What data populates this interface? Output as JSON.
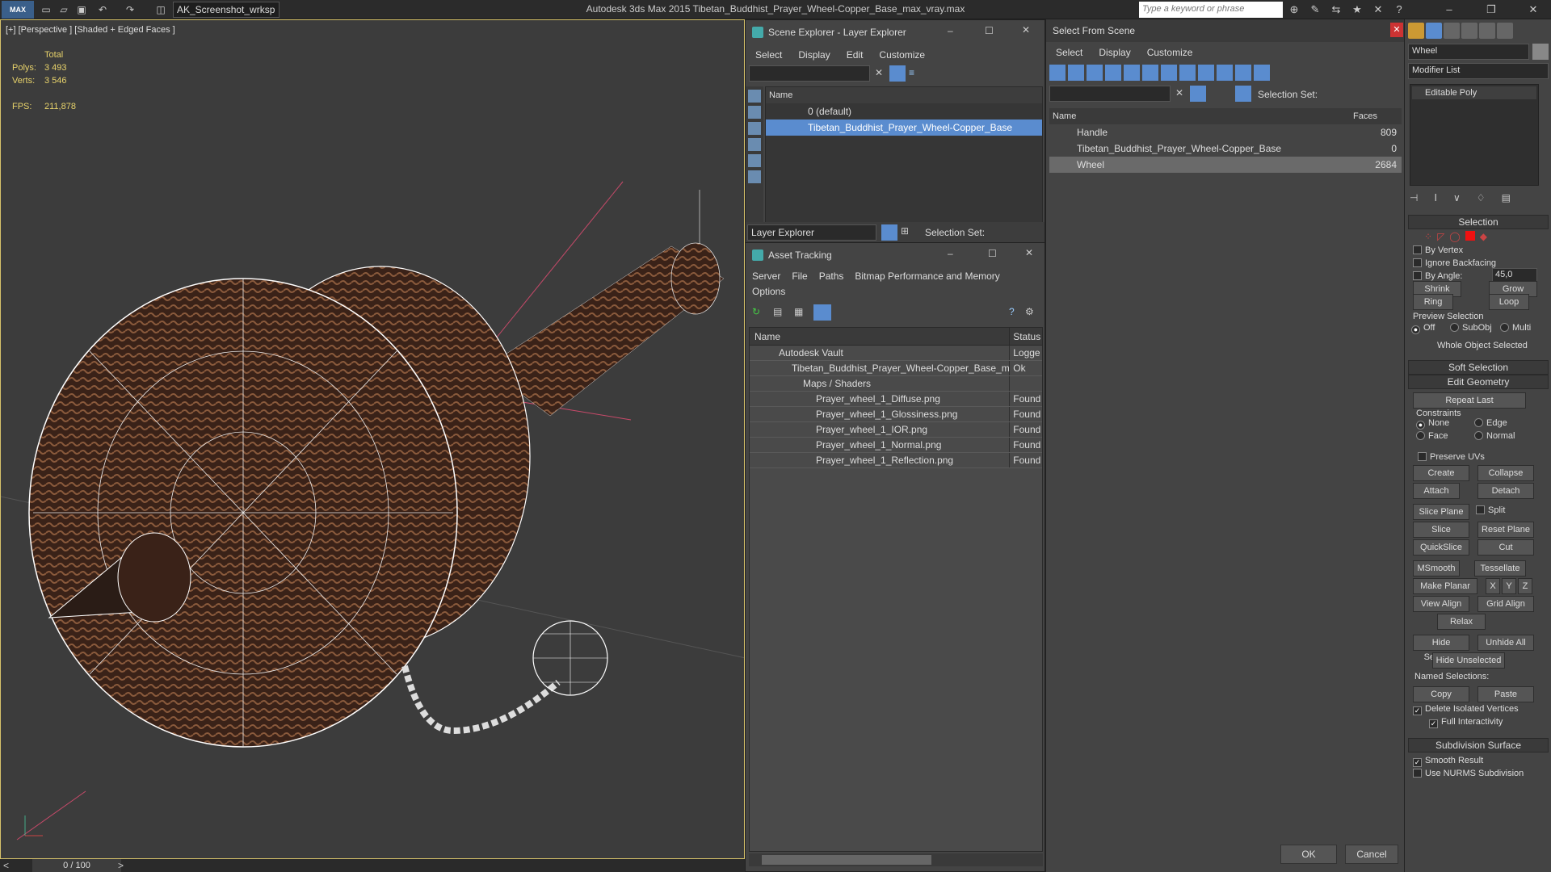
{
  "titlebar": {
    "workspace": "AK_Screenshot_wrksp",
    "app_title": "Autodesk 3ds Max  2015    Tibetan_Buddhist_Prayer_Wheel-Copper_Base_max_vray.max",
    "search_placeholder": "Type a keyword or phrase",
    "logo": "MAX"
  },
  "viewport": {
    "label": "[+] [Perspective ] [Shaded + Edged Faces ]",
    "stats": {
      "total_label": "Total",
      "polys_label": "Polys:",
      "polys": "3 493",
      "verts_label": "Verts:",
      "verts": "3 546",
      "fps_label": "FPS:",
      "fps": "211,878"
    }
  },
  "timeline": {
    "frame": "0 / 100"
  },
  "scene_explorer": {
    "title": "Scene Explorer - Layer Explorer",
    "menu": [
      "Select",
      "Display",
      "Edit",
      "Customize"
    ],
    "column": "Name",
    "rows": [
      "0 (default)",
      "Tibetan_Buddhist_Prayer_Wheel-Copper_Base"
    ],
    "footer_dropdown": "Layer Explorer",
    "selection_set": "Selection Set:"
  },
  "asset_tracking": {
    "title": "Asset Tracking",
    "menu": [
      "Server",
      "File",
      "Paths",
      "Bitmap Performance and Memory"
    ],
    "menu2": "Options",
    "col_name": "Name",
    "col_status": "Status",
    "rows": [
      {
        "name": "Autodesk Vault",
        "status": "Logge"
      },
      {
        "name": "Tibetan_Buddhist_Prayer_Wheel-Copper_Base_m...",
        "status": "Ok"
      },
      {
        "name": "Maps / Shaders",
        "status": ""
      },
      {
        "name": "Prayer_wheel_1_Diffuse.png",
        "status": "Found"
      },
      {
        "name": "Prayer_wheel_1_Glossiness.png",
        "status": "Found"
      },
      {
        "name": "Prayer_wheel_1_IOR.png",
        "status": "Found"
      },
      {
        "name": "Prayer_wheel_1_Normal.png",
        "status": "Found"
      },
      {
        "name": "Prayer_wheel_1_Reflection.png",
        "status": "Found"
      }
    ]
  },
  "select_from_scene": {
    "title": "Select From Scene",
    "menu": [
      "Select",
      "Display",
      "Customize"
    ],
    "selection_set": "Selection Set:",
    "col_name": "Name",
    "col_faces": "Faces",
    "rows": [
      {
        "name": "Handle",
        "faces": "809"
      },
      {
        "name": "Tibetan_Buddhist_Prayer_Wheel-Copper_Base",
        "faces": "0"
      },
      {
        "name": "Wheel",
        "faces": "2684"
      }
    ],
    "ok": "OK",
    "cancel": "Cancel"
  },
  "command_panel": {
    "object_name": "Wheel",
    "modifier_list": "Modifier List",
    "stack_item": "Editable Poly",
    "selection": {
      "header": "Selection",
      "by_vertex": "By Vertex",
      "ignore_backfacing": "Ignore Backfacing",
      "by_angle": "By Angle:",
      "angle_value": "45,0",
      "shrink": "Shrink",
      "grow": "Grow",
      "ring": "Ring",
      "loop": "Loop",
      "preview_selection": "Preview Selection",
      "off": "Off",
      "subobj": "SubObj",
      "multi": "Multi",
      "status": "Whole Object Selected"
    },
    "soft_selection": "Soft Selection",
    "edit_geometry": {
      "header": "Edit Geometry",
      "repeat_last": "Repeat Last",
      "constraints": "Constraints",
      "none": "None",
      "edge": "Edge",
      "face": "Face",
      "normal": "Normal",
      "preserve_uvs": "Preserve UVs",
      "create": "Create",
      "collapse": "Collapse",
      "attach": "Attach",
      "detach": "Detach",
      "slice_plane": "Slice Plane",
      "split": "Split",
      "slice": "Slice",
      "reset_plane": "Reset Plane",
      "quickslice": "QuickSlice",
      "cut": "Cut",
      "msmooth": "MSmooth",
      "tessellate": "Tessellate",
      "make_planar": "Make Planar",
      "x": "X",
      "y": "Y",
      "z": "Z",
      "view_align": "View Align",
      "grid_align": "Grid Align",
      "relax": "Relax",
      "hide_selected": "Hide Selected",
      "unhide_all": "Unhide All",
      "hide_unselected": "Hide Unselected",
      "named_selections": "Named Selections:",
      "copy": "Copy",
      "paste": "Paste",
      "delete_isolated": "Delete Isolated Vertices",
      "full_interactivity": "Full Interactivity"
    },
    "subdivision": {
      "header": "Subdivision Surface",
      "smooth_result": "Smooth Result",
      "use_nurms": "Use NURMS Subdivision"
    }
  },
  "colors": {
    "accent": "#5a8ccf",
    "stats": "#e8d36b",
    "viewport_border": "#d6c26a"
  }
}
